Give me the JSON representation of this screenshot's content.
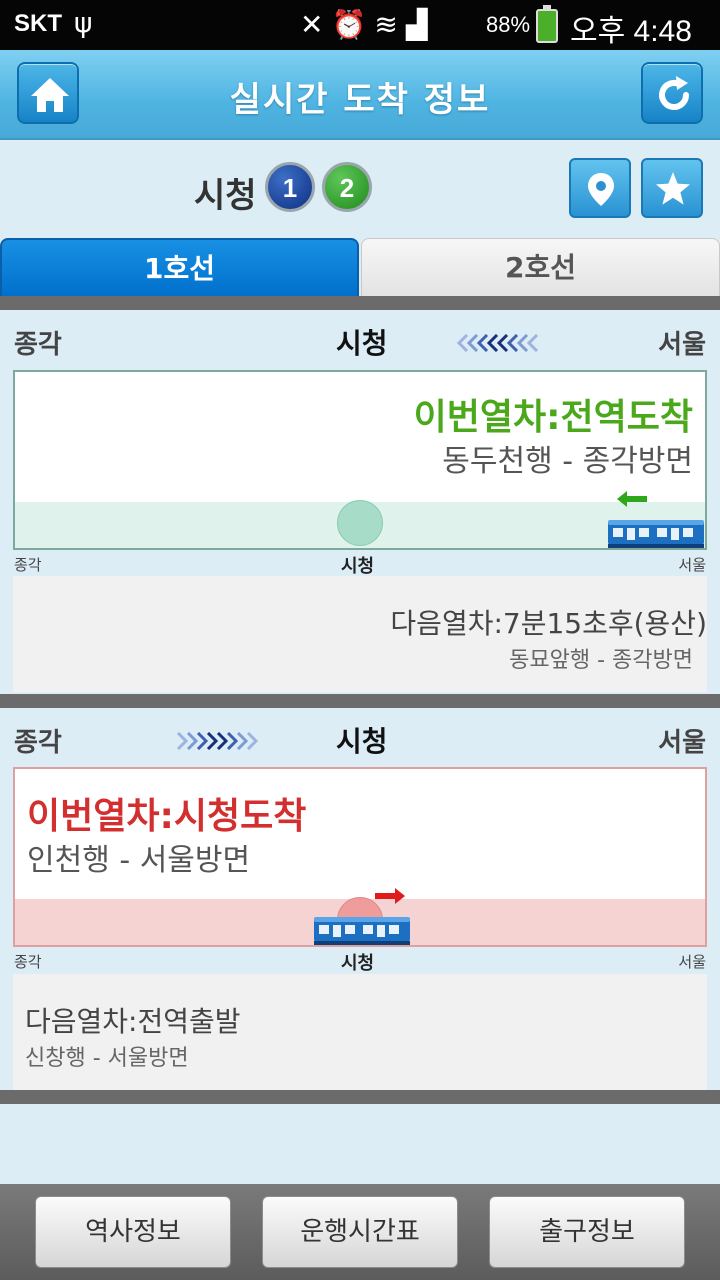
{
  "status_bar": {
    "carrier": "SKT",
    "battery_pct": "88%",
    "time": "오후 4:48"
  },
  "header": {
    "title": "실시간 도착 정보"
  },
  "station": {
    "name": "시청",
    "lines": [
      "1",
      "2"
    ]
  },
  "tabs": [
    {
      "label": "1호선"
    },
    {
      "label": "2호선"
    }
  ],
  "panels": [
    {
      "left_station": "종각",
      "current_station": "시청",
      "right_station": "서울",
      "current": {
        "status": "이번열차:전역도착",
        "destination": "동두천행 - 종각방면"
      },
      "next": {
        "status": "다음열차:7분15초후(용산)",
        "destination": "동묘앞행 - 종각방면"
      }
    },
    {
      "left_station": "종각",
      "current_station": "시청",
      "right_station": "서울",
      "current": {
        "status": "이번열차:시청도착",
        "destination": "인천행 - 서울방면"
      },
      "next": {
        "status": "다음열차:전역출발",
        "destination": "신창행 - 서울방면"
      }
    }
  ],
  "bottom_buttons": [
    {
      "label": "역사정보"
    },
    {
      "label": "운행시간표"
    },
    {
      "label": "출구정보"
    }
  ],
  "colors": {
    "line1": "#0d3b8f",
    "line2": "#2e9e2a",
    "arrival_prev": "#4aa81a",
    "arrival_now": "#d32f2f",
    "header": "#4fb4e2"
  }
}
